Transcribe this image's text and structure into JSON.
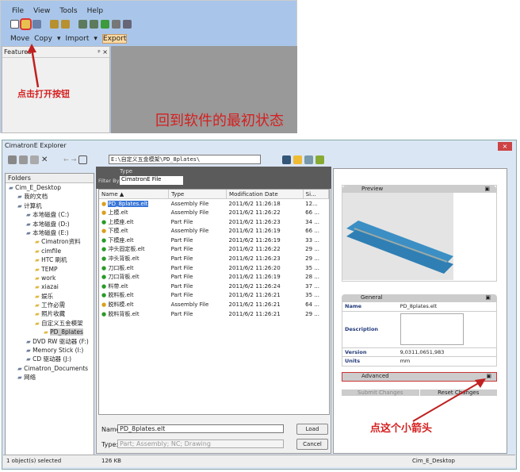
{
  "top": {
    "menu": [
      "File",
      "View",
      "Tools",
      "Help"
    ],
    "row2": [
      "Move",
      "Copy",
      "Import",
      "Export"
    ],
    "features_label": "Features",
    "features_controls": "ᵖ ×",
    "annotation_open": "点击打开按钮",
    "annotation_state": "回到软件的最初状态"
  },
  "explorer": {
    "title": "CimatronE Explorer",
    "path": "E:\\自定义五金模架\\PD_8plates\\",
    "folders_label": "Folders",
    "tree": [
      {
        "label": "Cim_E_Desktop",
        "lvl": 0
      },
      {
        "label": "我的文档",
        "lvl": 1
      },
      {
        "label": "计算机",
        "lvl": 1
      },
      {
        "label": "本地磁盘 (C:)",
        "lvl": 2
      },
      {
        "label": "本地磁盘 (D:)",
        "lvl": 2
      },
      {
        "label": "本地磁盘 (E:)",
        "lvl": 2
      },
      {
        "label": "Cimatron资料",
        "lvl": 3
      },
      {
        "label": "cimfile",
        "lvl": 3
      },
      {
        "label": "HTC 刷机",
        "lvl": 3
      },
      {
        "label": "TEMP",
        "lvl": 3
      },
      {
        "label": "work",
        "lvl": 3
      },
      {
        "label": "xiazai",
        "lvl": 3
      },
      {
        "label": "娱乐",
        "lvl": 3
      },
      {
        "label": "工作必需",
        "lvl": 3
      },
      {
        "label": "照片收藏",
        "lvl": 3
      },
      {
        "label": "自定义五金模架",
        "lvl": 3
      },
      {
        "label": "PD_8plates",
        "lvl": 4
      },
      {
        "label": "DVD RW 驱动器 (F:)",
        "lvl": 2
      },
      {
        "label": "Memory Stick (I:)",
        "lvl": 2
      },
      {
        "label": "CD 驱动器 (J:)",
        "lvl": 2
      },
      {
        "label": "Cimatron_Documents",
        "lvl": 1
      },
      {
        "label": "网络",
        "lvl": 1
      }
    ],
    "type_label": "Type",
    "filter_label": "Filter By:",
    "filter_value": "CimatronE File",
    "columns": [
      "Name  ▲",
      "Type",
      "Modification Date",
      "Si..."
    ],
    "files": [
      [
        "PD_8plates.elt",
        "Assembly File",
        "2011/6/2 11:26:18",
        "12..."
      ],
      [
        "上模.elt",
        "Assembly File",
        "2011/6/2 11:26:22",
        "66 ..."
      ],
      [
        "上模座.elt",
        "Part File",
        "2011/6/2 11:26:23",
        "34 ..."
      ],
      [
        "下模.elt",
        "Assembly File",
        "2011/6/2 11:26:19",
        "66 ..."
      ],
      [
        "下模座.elt",
        "Part File",
        "2011/6/2 11:26:19",
        "33 ..."
      ],
      [
        "冲头固定板.elt",
        "Part File",
        "2011/6/2 11:26:22",
        "29 ..."
      ],
      [
        "冲头背板.elt",
        "Part File",
        "2011/6/2 11:26:23",
        "29 ..."
      ],
      [
        "刀口板.elt",
        "Part File",
        "2011/6/2 11:26:20",
        "35 ..."
      ],
      [
        "刀口背板.elt",
        "Part File",
        "2011/6/2 11:26:19",
        "28 ..."
      ],
      [
        "料带.elt",
        "Part File",
        "2011/6/2 11:26:24",
        "37 ..."
      ],
      [
        "脱料板.elt",
        "Part File",
        "2011/6/2 11:26:21",
        "35 ..."
      ],
      [
        "脱料模.elt",
        "Assembly File",
        "2011/6/2 11:26:21",
        "64 ..."
      ],
      [
        "脱料背板.elt",
        "Part File",
        "2011/6/2 11:26:21",
        "29 ..."
      ]
    ],
    "name_label": "Name:",
    "name_value": "PD_8plates.elt",
    "type_field_label": "Type:",
    "type_value": "Part; Assembly; NC; Drawing",
    "load": "Load",
    "cancel": "Cancel",
    "preview_label": "Preview",
    "general_label": "General",
    "props": {
      "name_k": "Name",
      "name_v": "PD_8plates.elt",
      "desc_k": "Description",
      "ver_k": "Version",
      "ver_v": "9,0311,0651,983",
      "units_k": "Units",
      "units_v": "mm"
    },
    "advanced_label": "Advanced",
    "submit": "Submit Changes",
    "reset": "Reset Changes",
    "annotation_arrow": "点这个小箭头",
    "status": {
      "selected": "1 object(s) selected",
      "size": "126 KB",
      "location": "Cim_E_Desktop"
    }
  }
}
